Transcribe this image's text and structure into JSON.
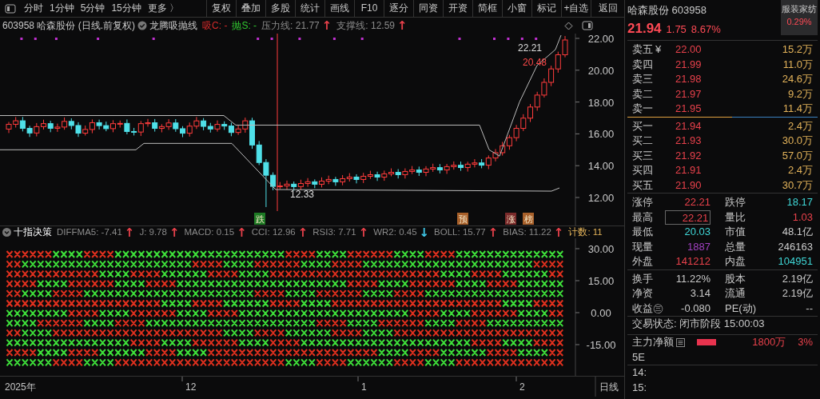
{
  "toolbar": {
    "periods": [
      "分时",
      "1分钟",
      "5分钟",
      "15分钟"
    ],
    "more": "更多 〉",
    "buttons": [
      "复权",
      "叠加",
      "多股",
      "统计",
      "画线",
      "F10",
      "逐分",
      "同资",
      "开资",
      "简框",
      "小窗",
      "标记",
      "+自选",
      "返回"
    ]
  },
  "chart_header": {
    "title": "603958 哈森股份 (日线.前复权)",
    "indicator": "龙腾吸抛线",
    "values": [
      {
        "label": "吸C: -",
        "color": "#d42a2a"
      },
      {
        "label": "抛S: -",
        "color": "#31c931"
      },
      {
        "label": "压力线: 21.77",
        "arrow": {
          "text": "↑",
          "color": "#e8414b"
        }
      },
      {
        "label": "支撑线: 12.59",
        "arrow": {
          "text": "↑",
          "color": "#e8414b"
        }
      }
    ]
  },
  "price_axis": [
    "22.00",
    "20.00",
    "18.00",
    "16.00",
    "14.00",
    "12.00"
  ],
  "chart_labels": {
    "high": "22.21",
    "last": "20.48",
    "low": "12.33"
  },
  "signal_badges": [
    {
      "text": "跌",
      "color": "#1d7a24"
    },
    {
      "text": "预",
      "color": "#a8602a"
    },
    {
      "text": "涨",
      "color": "#7a2a2a"
    },
    {
      "text": "榜",
      "color": "#a8602a"
    }
  ],
  "indicator_header": {
    "title": "十指决策",
    "values": [
      {
        "label": "DIFFMA5: -7.41",
        "arrow": {
          "text": "↑",
          "color": "#e8414b"
        }
      },
      {
        "label": "J: 9.78",
        "arrow": {
          "text": "↑",
          "color": "#e8414b"
        }
      },
      {
        "label": "MACD: 0.15",
        "arrow": {
          "text": "↑",
          "color": "#e8414b"
        }
      },
      {
        "label": "CCI: 12.96",
        "arrow": {
          "text": "↑",
          "color": "#e8414b"
        }
      },
      {
        "label": "RSI3: 7.71",
        "arrow": {
          "text": "↑",
          "color": "#e8414b"
        }
      },
      {
        "label": "WR2: 0.45",
        "arrow": {
          "text": "↓",
          "color": "#3fc8e8"
        }
      },
      {
        "label": "BOLL: 15.77",
        "arrow": {
          "text": "↑",
          "color": "#e8414b"
        }
      },
      {
        "label": "BIAS: 11.22",
        "arrow": {
          "text": "↑",
          "color": "#e8414b"
        }
      }
    ],
    "count": "计数: 11"
  },
  "indicator_axis": [
    "30.00",
    "15.00",
    "0.00",
    "-15.00"
  ],
  "date_axis": [
    "2025年",
    "12",
    "1",
    "2"
  ],
  "period_label": "日线",
  "quote": {
    "name": "哈森股份",
    "code": "603958",
    "sector": "服装家纺",
    "sector_change": "0.29%",
    "price": "21.94",
    "change": "1.75",
    "change_pct": "8.67%"
  },
  "currency_symbol": "¥",
  "asks": [
    {
      "label": "卖五",
      "price": "22.00",
      "volume": "15.2万"
    },
    {
      "label": "卖四",
      "price": "21.99",
      "volume": "11.0万"
    },
    {
      "label": "卖三",
      "price": "21.98",
      "volume": "24.6万"
    },
    {
      "label": "卖二",
      "price": "21.97",
      "volume": "9.2万"
    },
    {
      "label": "卖一",
      "price": "21.95",
      "volume": "11.4万"
    }
  ],
  "bids": [
    {
      "label": "买一",
      "price": "21.94",
      "volume": "2.4万"
    },
    {
      "label": "买二",
      "price": "21.93",
      "volume": "30.0万"
    },
    {
      "label": "买三",
      "price": "21.92",
      "volume": "57.0万"
    },
    {
      "label": "买四",
      "price": "21.91",
      "volume": "2.4万"
    },
    {
      "label": "买五",
      "price": "21.90",
      "volume": "30.7万"
    }
  ],
  "stats": [
    [
      {
        "label": "涨停",
        "value": "22.21",
        "color": "#e8414b",
        "highlighted": false
      },
      {
        "label": "跌停",
        "value": "18.17",
        "color": "#3fd6d6",
        "highlighted": false
      }
    ],
    [
      {
        "label": "最高",
        "value": "22.21",
        "color": "#e8414b",
        "highlighted": true
      },
      {
        "label": "量比",
        "value": "1.03",
        "color": "#e8414b",
        "highlighted": false
      }
    ],
    [
      {
        "label": "最低",
        "value": "20.03",
        "color": "#3fd6d6",
        "highlighted": false
      },
      {
        "label": "市值",
        "value": "48.1亿",
        "color": "#cccccc",
        "highlighted": false
      }
    ],
    [
      {
        "label": "现量",
        "value": "1887",
        "color": "#a040c0",
        "highlighted": false
      },
      {
        "label": "总量",
        "value": "246163",
        "color": "#cccccc",
        "highlighted": false
      }
    ],
    [
      {
        "label": "外盘",
        "value": "141212",
        "color": "#e8414b",
        "highlighted": false
      },
      {
        "label": "内盘",
        "value": "104951",
        "color": "#3fd6d6",
        "highlighted": false
      }
    ]
  ],
  "fundamentals": [
    [
      {
        "label": "换手",
        "value": "11.22%"
      },
      {
        "label": "股本",
        "value": "2.19亿"
      }
    ],
    [
      {
        "label": "净资",
        "value": "3.14"
      },
      {
        "label": "流通",
        "value": "2.19亿"
      }
    ],
    [
      {
        "label": "收益㊂",
        "value": "-0.080"
      },
      {
        "label": "PE(动)",
        "value": "--"
      }
    ]
  ],
  "trade_status": "交易状态: 闭市阶段 15:00:03",
  "main_flow": {
    "label": "主力净额",
    "amount": "1800万",
    "percent": "3%"
  },
  "partial_rows": [
    "5E",
    "14:",
    "15:"
  ]
}
